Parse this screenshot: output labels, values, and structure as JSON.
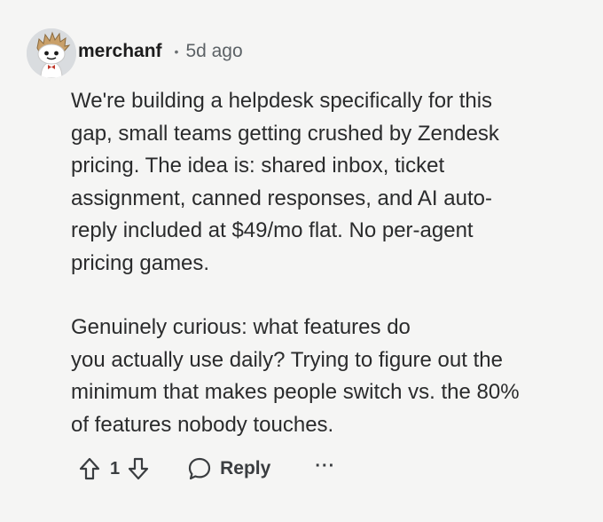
{
  "comment": {
    "author": "merchanf",
    "separator": "•",
    "age": "5d ago",
    "paragraphs": [
      "We're building a helpdesk specifically for this\ngap, small teams getting crushed by Zendesk\npricing. The idea is: shared inbox, ticket\nassignment, canned responses, and AI auto-\nreply included at $49/mo flat. No per-agent\npricing games.",
      "Genuinely curious: what features do\nyou actually use daily? Trying to figure out the\nminimum that makes people switch vs. the 80%\nof features nobody touches."
    ]
  },
  "actions": {
    "upvote_icon": "arrow-up-icon",
    "vote_count": "1",
    "downvote_icon": "arrow-down-icon",
    "reply_icon": "speech-bubble-icon",
    "reply_label": "Reply",
    "more_label": "···"
  },
  "colors": {
    "background": "#f5f5f4",
    "text": "#2a2b2c",
    "muted": "#5c6266"
  }
}
